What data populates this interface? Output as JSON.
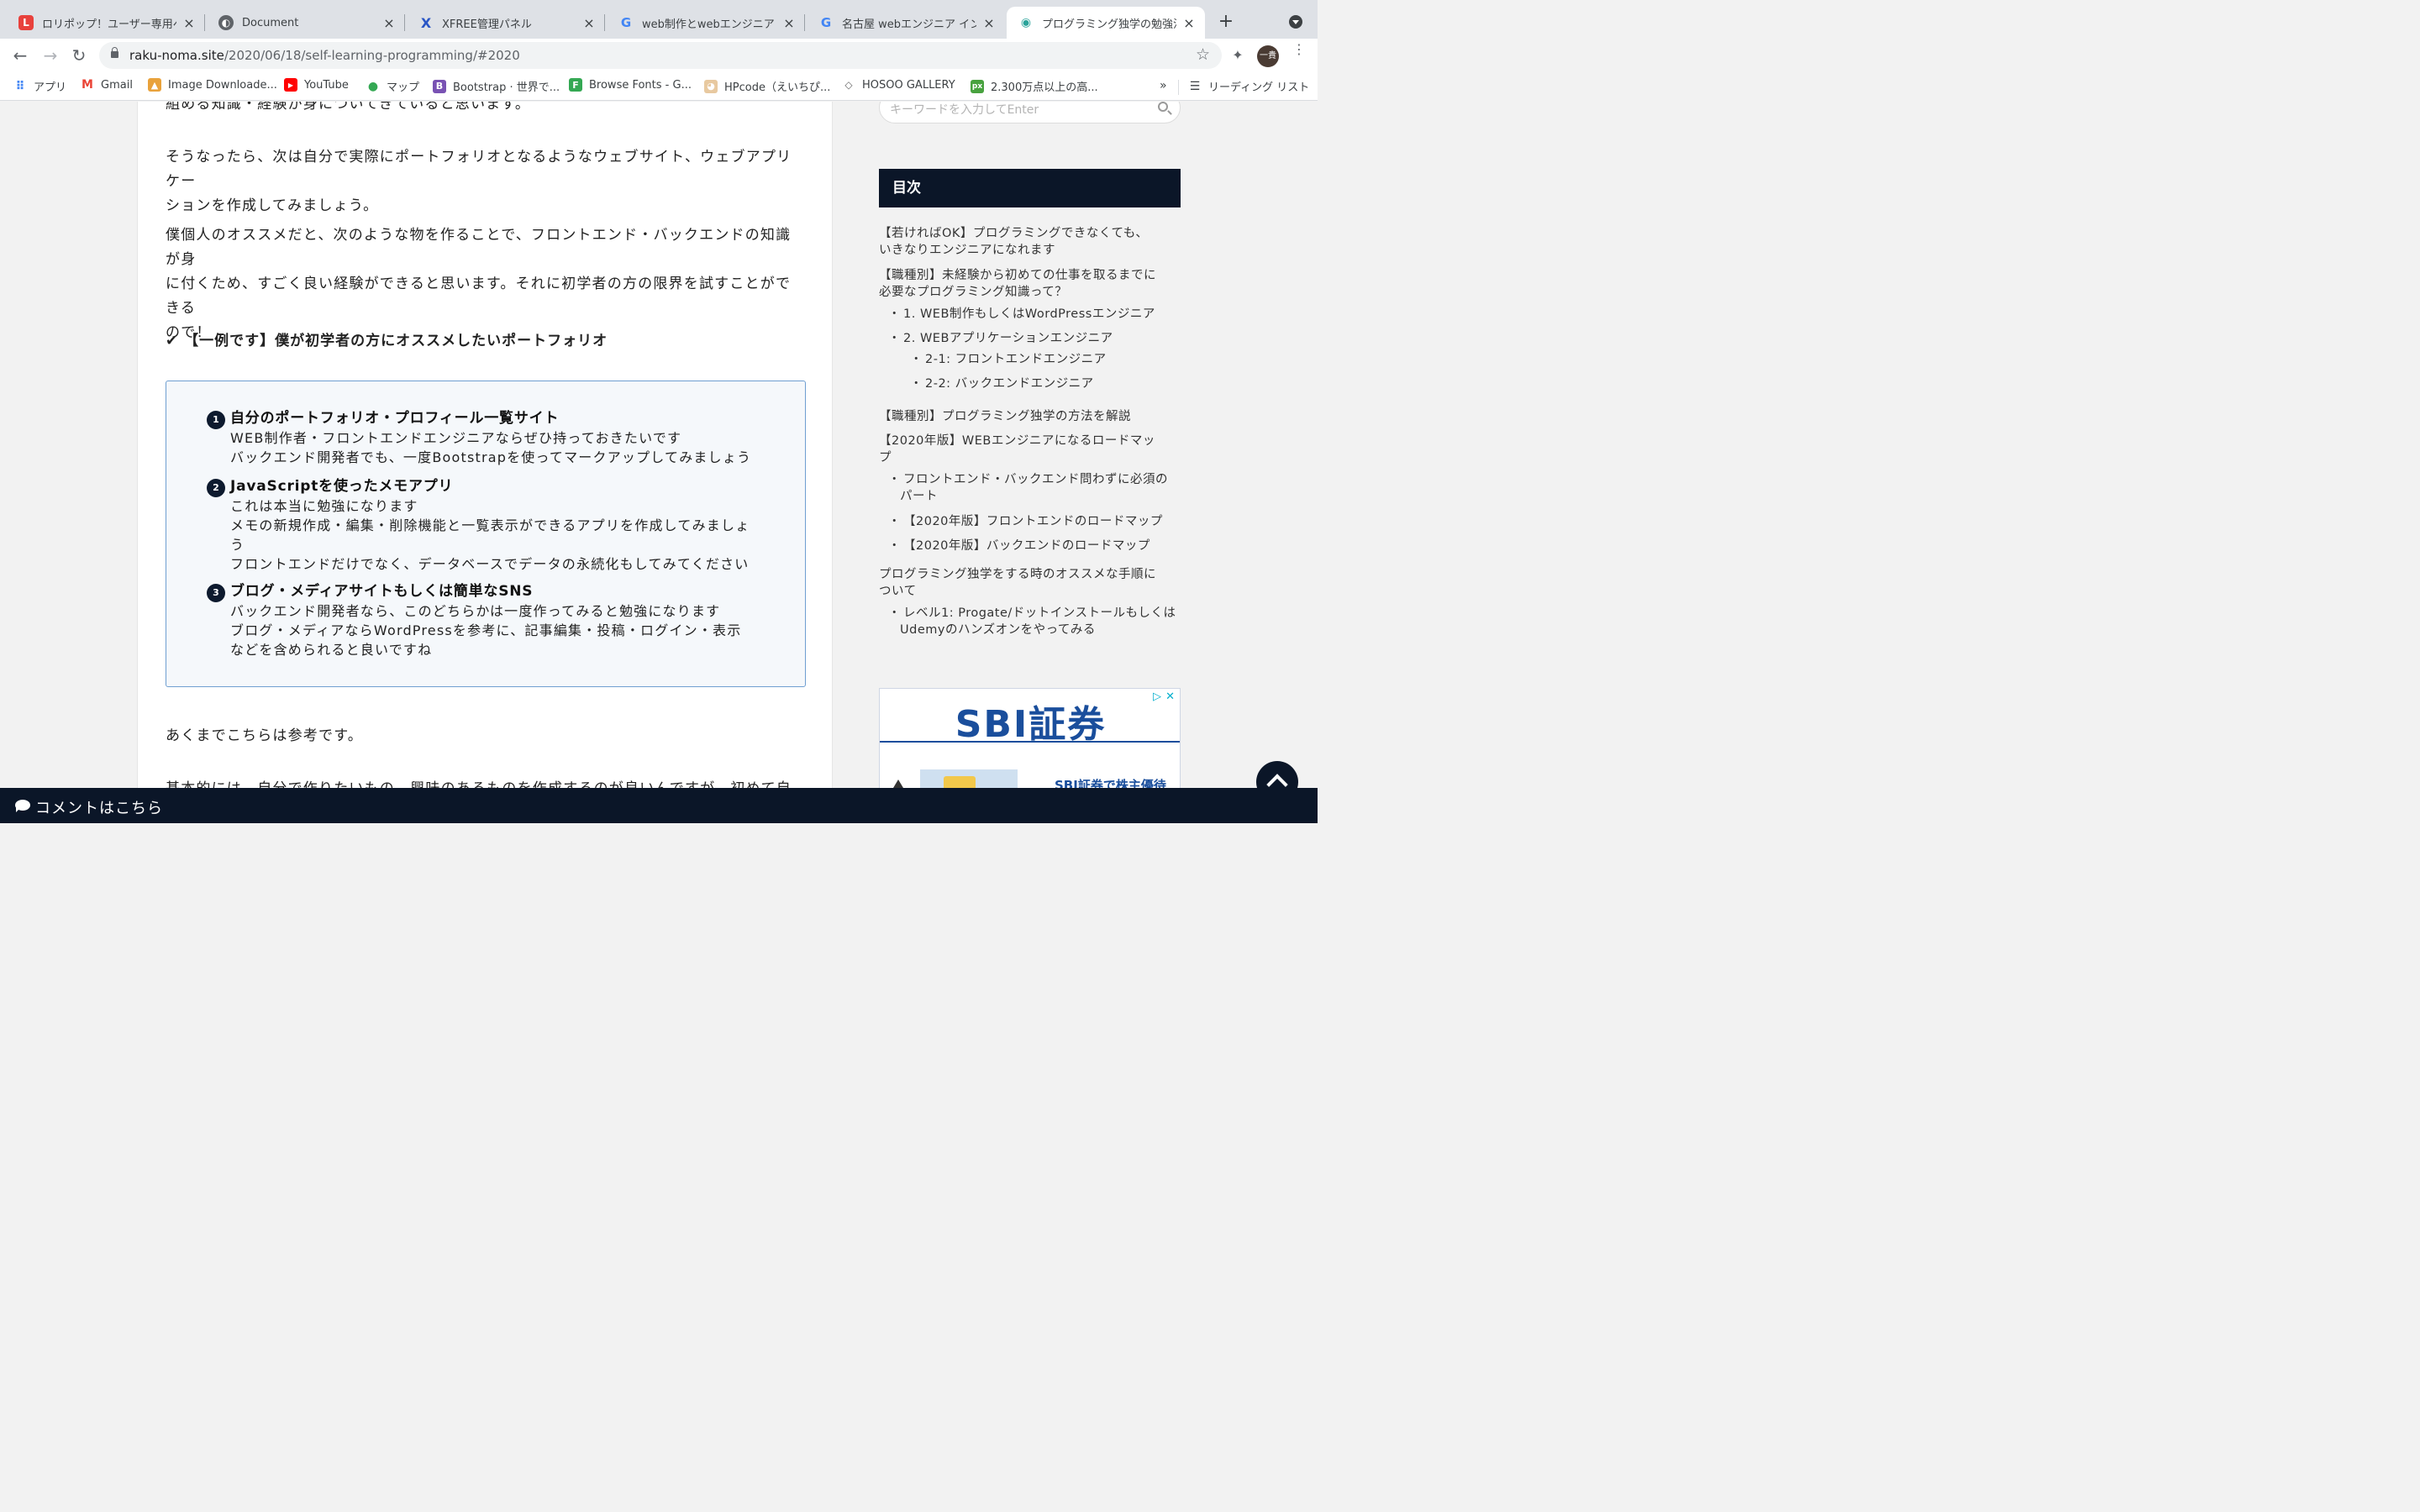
{
  "browser": {
    "tabs": [
      {
        "title": "ロリポップ！ユーザー専用ペー",
        "favicon_color": "#e8413c",
        "glyph": "L"
      },
      {
        "title": "Document",
        "favicon_color": "#5f6368",
        "glyph": "◐"
      },
      {
        "title": "XFREE管理パネル",
        "favicon_color": "#ffffff",
        "glyph": "X"
      },
      {
        "title": "web制作とwebエンジニア - G",
        "favicon_color": "#ffffff",
        "glyph": "G"
      },
      {
        "title": "名古屋 webエンジニア インタ",
        "favicon_color": "#ffffff",
        "glyph": "G"
      },
      {
        "title": "プログラミング独学の勉強法 -",
        "favicon_color": "#ffffff",
        "glyph": "◉"
      }
    ],
    "tab_close": "×",
    "new_tab": "+",
    "url_host": "raku-noma.site",
    "url_path": "/2020/06/18/self-learning-programming/#2020",
    "profile_label": "一貴",
    "bookmarks": [
      {
        "label": "アプリ",
        "icon": "apps-grid-icon"
      },
      {
        "label": "Gmail",
        "icon": "gmail-icon"
      },
      {
        "label": "Image Downloade...",
        "icon": "image-downloader-icon"
      },
      {
        "label": "YouTube",
        "icon": "youtube-icon"
      },
      {
        "label": "マップ",
        "icon": "maps-icon"
      },
      {
        "label": "Bootstrap · 世界で...",
        "icon": "bootstrap-icon"
      },
      {
        "label": "Browse Fonts - G...",
        "icon": "google-fonts-icon"
      },
      {
        "label": "HPcode（えいちぴ...",
        "icon": "hpcode-icon"
      },
      {
        "label": "HOSOO GALLERY",
        "icon": "hosoo-icon"
      },
      {
        "label": "2.300万点以上の高...",
        "icon": "pixabay-icon"
      }
    ],
    "bookmarks_overflow": "»",
    "reading_list": "リーディング リスト"
  },
  "article": {
    "para_top": "組める知識・経験が身についてきていると思います。",
    "para1_l1": "そうなったら、次は自分で実際にポートフォリオとなるようなウェブサイト、ウェブアプリケー",
    "para1_l2": "ションを作成してみましょう。",
    "para2_l1": "僕個人のオススメだと、次のような物を作ることで、フロントエンド・バックエンドの知識が身",
    "para2_l2": "に付くため、すごく良い経験ができると思います。それに初学者の方の限界を試すことができる",
    "para2_l3": "ので！",
    "check_mark": "✔",
    "check_heading": "【一例です】僕が初学者の方にオススメしたいポートフォリオ",
    "portfolio": [
      {
        "num": "1",
        "title": "自分のポートフォリオ・プロフィール一覧サイト",
        "lines": [
          "WEB制作者・フロントエンドエンジニアならぜひ持っておきたいです",
          "バックエンド開発者でも、一度Bootstrapを使ってマークアップしてみましょう"
        ]
      },
      {
        "num": "2",
        "title": "JavaScriptを使ったメモアプリ",
        "lines": [
          "これは本当に勉強になります",
          "メモの新規作成・編集・削除機能と一覧表示ができるアプリを作成してみましょ",
          "う",
          "フロントエンドだけでなく、データベースでデータの永続化もしてみてください"
        ]
      },
      {
        "num": "3",
        "title": "ブログ・メディアサイトもしくは簡単なSNS",
        "lines": [
          "バックエンド開発者なら、このどちらかは一度作ってみると勉強になります",
          "ブログ・メディアならWordPressを参考に、記事編集・投稿・ログイン・表示",
          "などを含められると良いですね"
        ]
      }
    ],
    "para3": "あくまでこちらは参考です。",
    "para4_cut": "基本的には、自分で作りたいもの、興味のあるものを作成するのが良いんですが、初めて自分で"
  },
  "sidebar": {
    "search_placeholder": "キーワードを入力してEnter",
    "toc_title": "目次",
    "toc": [
      {
        "text": "【若ければOK】プログラミングできなくても、",
        "level": 1
      },
      {
        "text": "いきなりエンジニアになれます",
        "level": 1
      },
      {
        "text": "【職種別】未経験から初めての仕事を取るまでに",
        "level": 1
      },
      {
        "text": "必要なプログラミング知識って？",
        "level": 1
      },
      {
        "text": "1. WEB制作もしくはWordPressエンジニア",
        "level": 2
      },
      {
        "text": "2. WEBアプリケーションエンジニア",
        "level": 2
      },
      {
        "text": "2-1: フロントエンドエンジニア",
        "level": 3
      },
      {
        "text": "2-2: バックエンドエンジニア",
        "level": 3
      },
      {
        "text": "【職種別】プログラミング独学の方法を解説",
        "level": 1
      },
      {
        "text": "【2020年版】WEBエンジニアになるロードマッ",
        "level": 1
      },
      {
        "text": "プ",
        "level": 1
      },
      {
        "text": "フロントエンド・バックエンド問わずに必須の",
        "level": 2
      },
      {
        "text": "パート",
        "level": 2
      },
      {
        "text": "【2020年版】フロントエンドのロードマップ",
        "level": 2
      },
      {
        "text": "【2020年版】バックエンドのロードマップ",
        "level": 2
      },
      {
        "text": "プログラミング独学をする時のオススメな手順に",
        "level": 1
      },
      {
        "text": "ついて",
        "level": 1
      },
      {
        "text": "レベル1: Progate/ドットインストールもしくは",
        "level": 2
      },
      {
        "text": "Udemyのハンズオンをやってみる",
        "level": 2
      }
    ],
    "ad_logo": "SBI証券",
    "ad_sub": "SBI証券で株主優待",
    "ad_choice": "▷",
    "ad_close": "✕"
  },
  "comment_bar": "コメントはこちら"
}
